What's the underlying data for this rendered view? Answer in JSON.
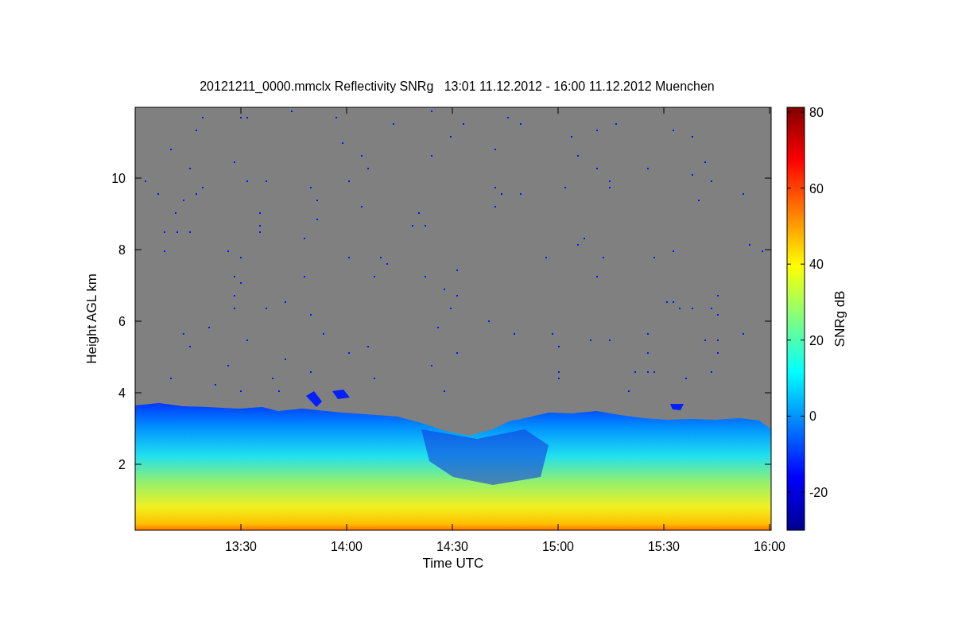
{
  "plot": {
    "title": "20121211_0000.mmclx Reflectivity SNRg   13:01 11.12.2012 - 16:00 11.12.2012 Muenchen",
    "ylabel": "Height AGL km",
    "xlabel": "Time UTC",
    "yticks": [
      "10",
      "8",
      "6",
      "4",
      "2"
    ],
    "xticks": [
      "13:30",
      "14:00",
      "14:30",
      "15:00",
      "15:30",
      "16:00"
    ],
    "colorbar": {
      "label": "SNRg dB",
      "ticks": [
        "80",
        "60",
        "40",
        "20",
        "0",
        "-20"
      ]
    }
  }
}
